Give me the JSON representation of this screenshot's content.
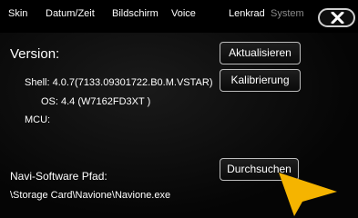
{
  "tabs": [
    {
      "label": "Skin"
    },
    {
      "label": "Datum/Zeit"
    },
    {
      "label": "Bildschirm"
    },
    {
      "label": "Voice"
    },
    {
      "label": "Lenkrad"
    },
    {
      "label": "System"
    }
  ],
  "version_section": {
    "title": "Version:",
    "shell": "Shell: 4.0.7(7133.09301722.B0.M.VSTAR)",
    "os": "OS:  4.4 (W7162FD3XT  )",
    "mcu": "MCU:"
  },
  "buttons": {
    "update": "Aktualisieren",
    "calibrate": "Kalibrierung",
    "browse": "Durchsuchen"
  },
  "navi": {
    "label": "Navi-Software Pfad:",
    "path": "\\Storage Card\\Navione\\Navione.exe"
  },
  "colors": {
    "accent_pointer": "#f5b400",
    "disabled_tab": "#8a8a8a"
  }
}
